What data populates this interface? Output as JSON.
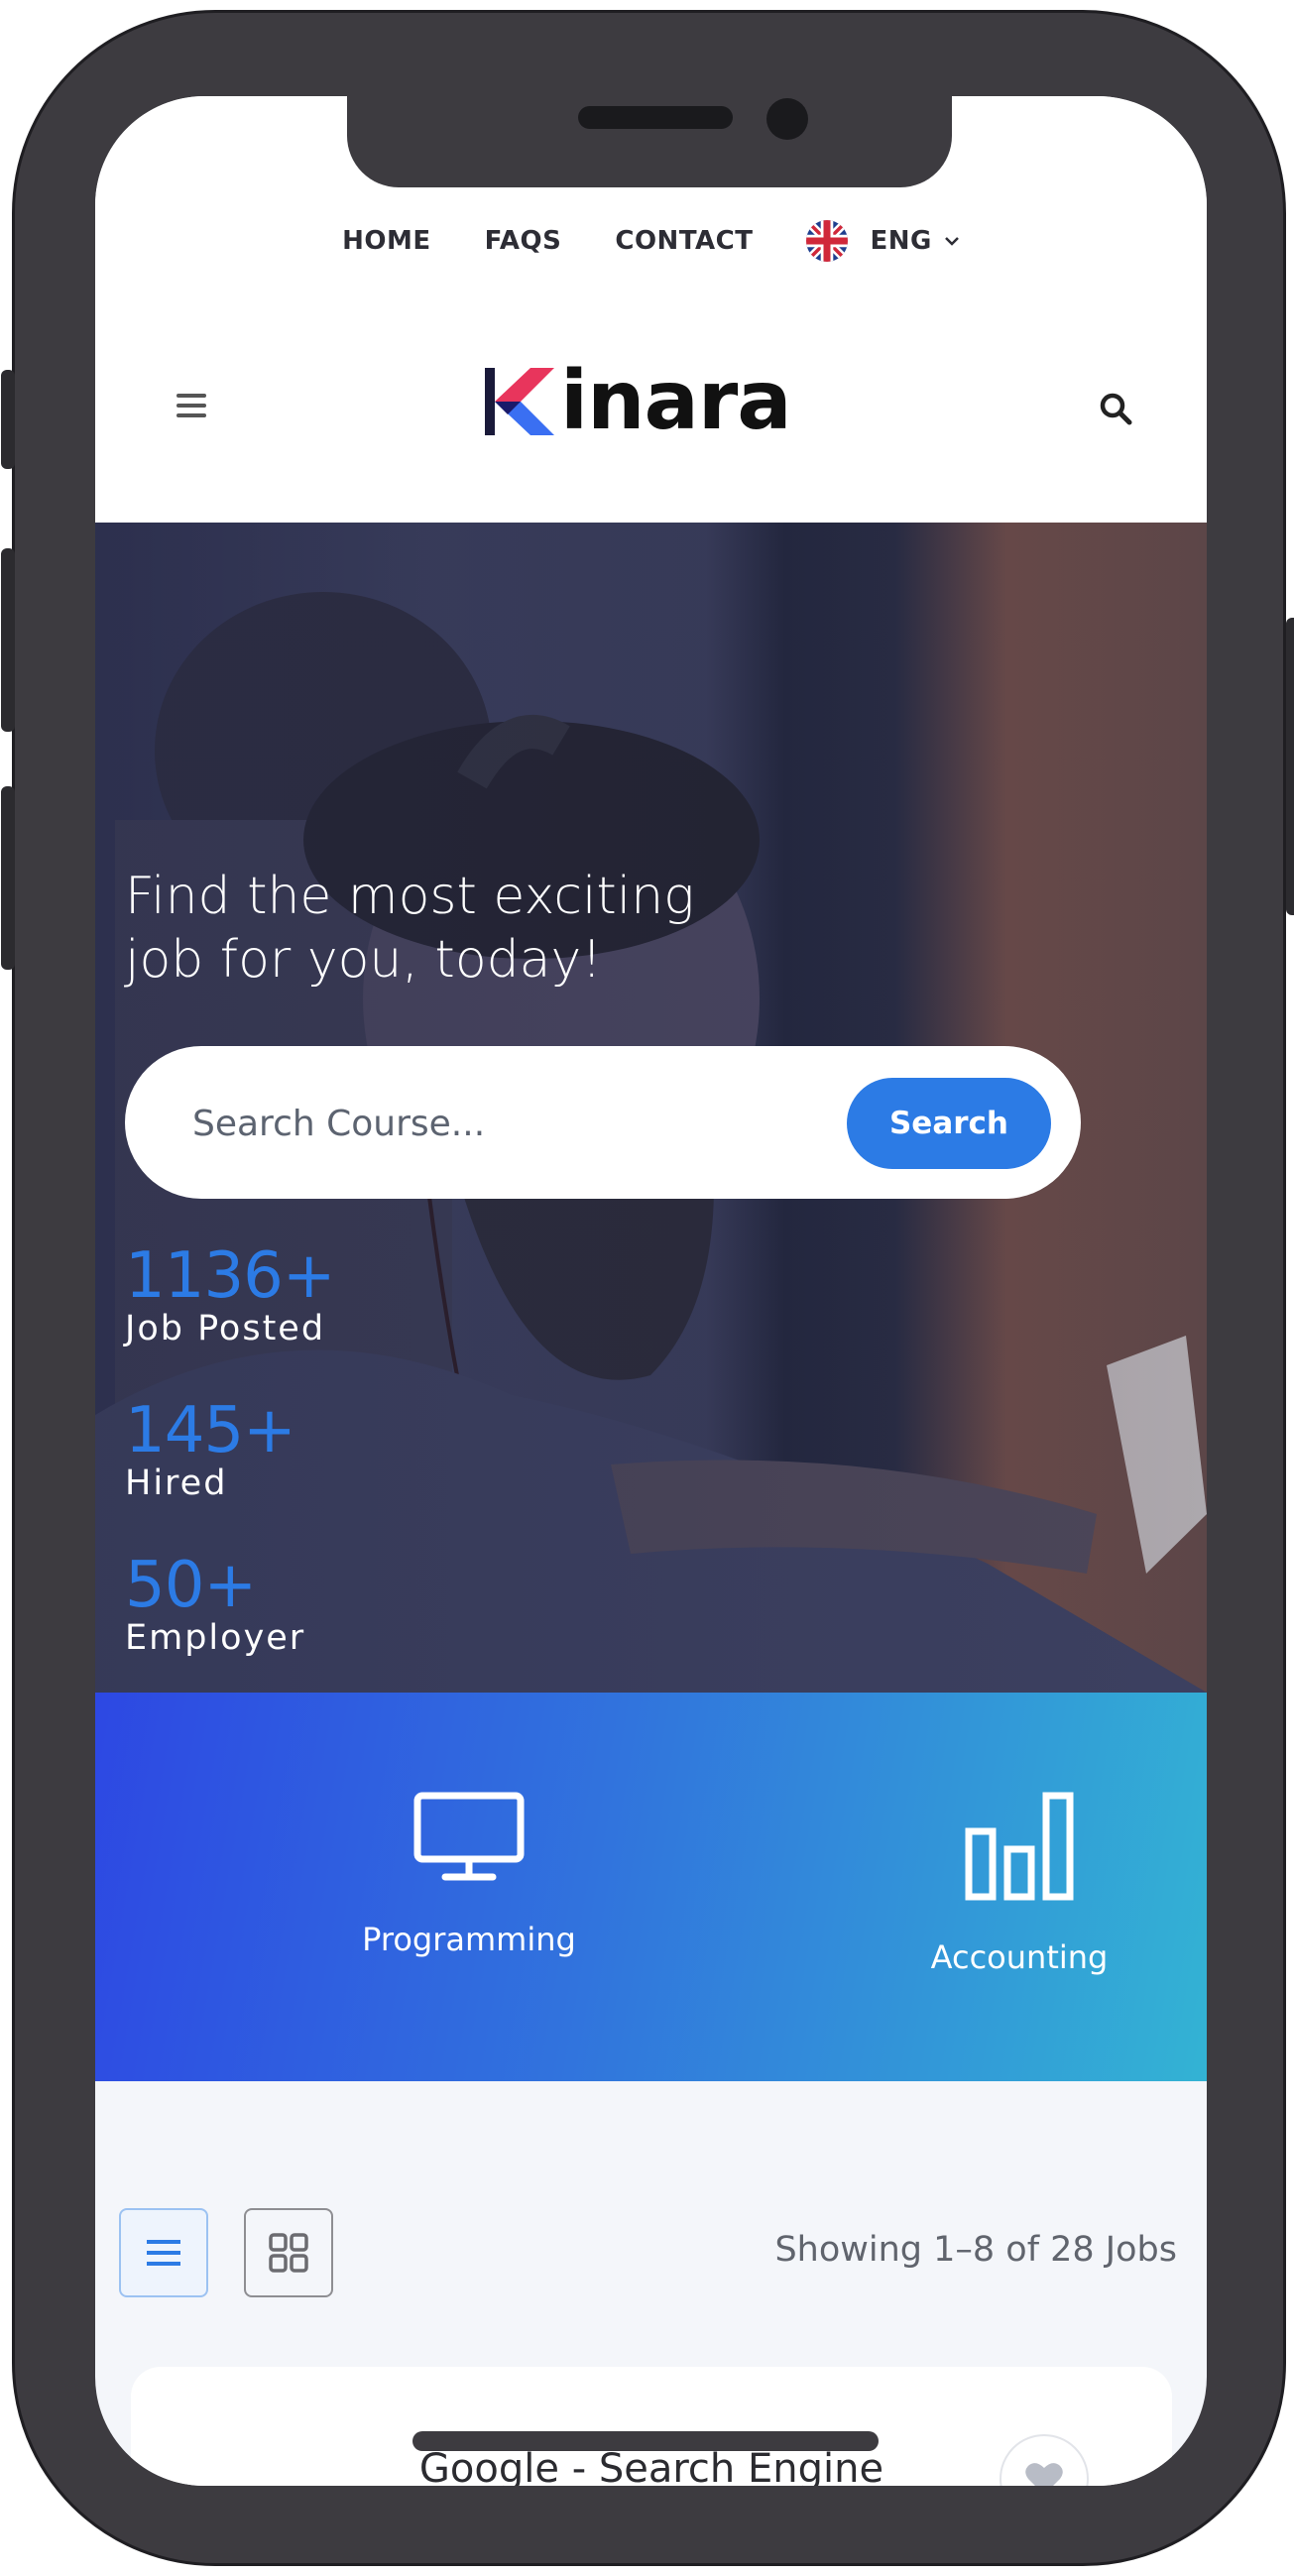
{
  "topnav": {
    "links": [
      "HOME",
      "FAQS",
      "CONTACT"
    ],
    "language": "ENG"
  },
  "header": {
    "logo_text": "inara",
    "logo_letter": "K"
  },
  "hero": {
    "title_line1": "Find the most exciting",
    "title_line2": "job for you, today!",
    "search_placeholder": "Search Course...",
    "search_button": "Search",
    "stats": [
      {
        "value": "1136+",
        "label": "Job Posted"
      },
      {
        "value": "145+",
        "label": "Hired"
      },
      {
        "value": "50+",
        "label": "Employer"
      }
    ]
  },
  "categories": [
    {
      "label": "Programming",
      "icon": "monitor-icon"
    },
    {
      "label": "Accounting",
      "icon": "bar-chart-icon"
    }
  ],
  "listing": {
    "showing_text": "Showing 1–8 of 28 Jobs",
    "first_job_title": "Google - Search Engine"
  },
  "colors": {
    "accent": "#2c7be5",
    "gradient_start": "#2d48e3",
    "gradient_end": "#33b3d4",
    "frame": "#3d3b40"
  }
}
